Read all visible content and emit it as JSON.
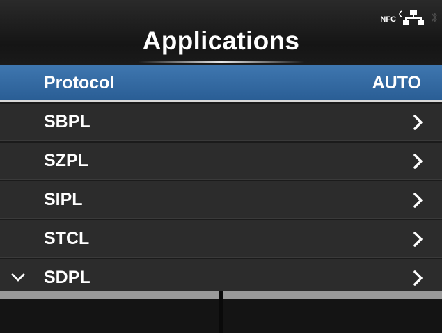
{
  "header": {
    "title": "Applications",
    "status": {
      "nfc_label": "NFC",
      "icons": [
        "nfc-icon",
        "network-icon",
        "bluetooth-icon"
      ]
    }
  },
  "list": {
    "selected_index": 0,
    "items": [
      {
        "label": "Protocol",
        "value": "AUTO"
      },
      {
        "label": "SBPL",
        "icon": "chevron-right-icon"
      },
      {
        "label": "SZPL",
        "icon": "chevron-right-icon"
      },
      {
        "label": "SIPL",
        "icon": "chevron-right-icon"
      },
      {
        "label": "STCL",
        "icon": "chevron-right-icon"
      },
      {
        "label": "SDPL",
        "icon": "chevron-right-icon"
      }
    ],
    "more_below_icon": "chevron-down-icon"
  },
  "softkeys": {
    "left_label": "",
    "right_label": ""
  },
  "colors": {
    "selected_row": "#3a6ea6",
    "row_bg": "#2c2c2c",
    "text": "#ffffff"
  }
}
